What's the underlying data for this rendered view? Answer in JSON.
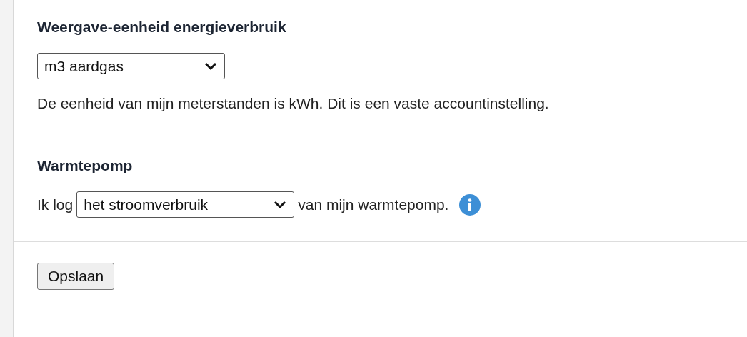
{
  "sections": [
    {
      "kind": "block",
      "heading": "Weergave-eenheid energieverbruik",
      "select": {
        "value": "m3 aardgas"
      },
      "note": "De eenheid van mijn meterstanden is kWh. Dit is een vaste accountinstelling."
    },
    {
      "kind": "inline",
      "heading": "Warmtepomp",
      "prefix": "Ik log",
      "select": {
        "value": "het stroomverbruik"
      },
      "suffix": "van mijn warmtepomp.",
      "info": true
    }
  ],
  "save_button": "Opslaan"
}
